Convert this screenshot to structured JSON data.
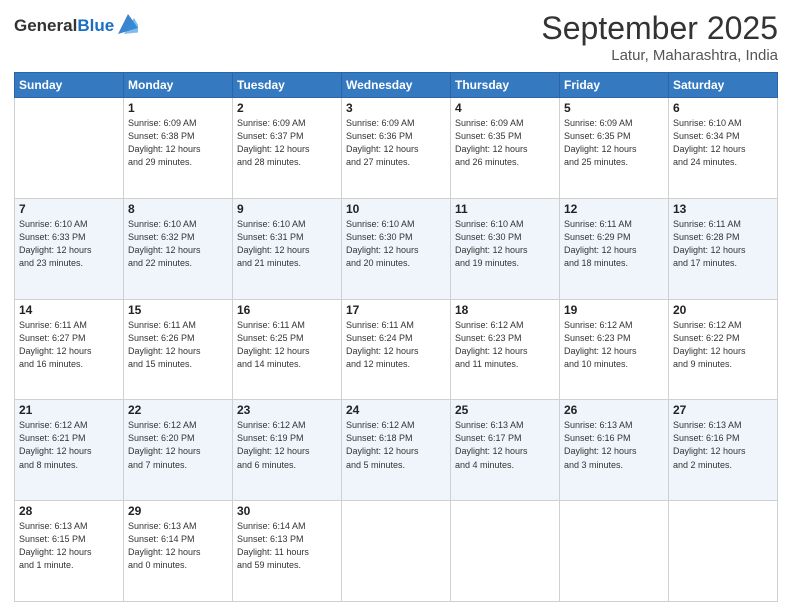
{
  "logo": {
    "general": "General",
    "blue": "Blue"
  },
  "header": {
    "month": "September 2025",
    "location": "Latur, Maharashtra, India"
  },
  "weekdays": [
    "Sunday",
    "Monday",
    "Tuesday",
    "Wednesday",
    "Thursday",
    "Friday",
    "Saturday"
  ],
  "weeks": [
    [
      {
        "day": "",
        "info": ""
      },
      {
        "day": "1",
        "info": "Sunrise: 6:09 AM\nSunset: 6:38 PM\nDaylight: 12 hours\nand 29 minutes."
      },
      {
        "day": "2",
        "info": "Sunrise: 6:09 AM\nSunset: 6:37 PM\nDaylight: 12 hours\nand 28 minutes."
      },
      {
        "day": "3",
        "info": "Sunrise: 6:09 AM\nSunset: 6:36 PM\nDaylight: 12 hours\nand 27 minutes."
      },
      {
        "day": "4",
        "info": "Sunrise: 6:09 AM\nSunset: 6:35 PM\nDaylight: 12 hours\nand 26 minutes."
      },
      {
        "day": "5",
        "info": "Sunrise: 6:09 AM\nSunset: 6:35 PM\nDaylight: 12 hours\nand 25 minutes."
      },
      {
        "day": "6",
        "info": "Sunrise: 6:10 AM\nSunset: 6:34 PM\nDaylight: 12 hours\nand 24 minutes."
      }
    ],
    [
      {
        "day": "7",
        "info": "Sunrise: 6:10 AM\nSunset: 6:33 PM\nDaylight: 12 hours\nand 23 minutes."
      },
      {
        "day": "8",
        "info": "Sunrise: 6:10 AM\nSunset: 6:32 PM\nDaylight: 12 hours\nand 22 minutes."
      },
      {
        "day": "9",
        "info": "Sunrise: 6:10 AM\nSunset: 6:31 PM\nDaylight: 12 hours\nand 21 minutes."
      },
      {
        "day": "10",
        "info": "Sunrise: 6:10 AM\nSunset: 6:30 PM\nDaylight: 12 hours\nand 20 minutes."
      },
      {
        "day": "11",
        "info": "Sunrise: 6:10 AM\nSunset: 6:30 PM\nDaylight: 12 hours\nand 19 minutes."
      },
      {
        "day": "12",
        "info": "Sunrise: 6:11 AM\nSunset: 6:29 PM\nDaylight: 12 hours\nand 18 minutes."
      },
      {
        "day": "13",
        "info": "Sunrise: 6:11 AM\nSunset: 6:28 PM\nDaylight: 12 hours\nand 17 minutes."
      }
    ],
    [
      {
        "day": "14",
        "info": "Sunrise: 6:11 AM\nSunset: 6:27 PM\nDaylight: 12 hours\nand 16 minutes."
      },
      {
        "day": "15",
        "info": "Sunrise: 6:11 AM\nSunset: 6:26 PM\nDaylight: 12 hours\nand 15 minutes."
      },
      {
        "day": "16",
        "info": "Sunrise: 6:11 AM\nSunset: 6:25 PM\nDaylight: 12 hours\nand 14 minutes."
      },
      {
        "day": "17",
        "info": "Sunrise: 6:11 AM\nSunset: 6:24 PM\nDaylight: 12 hours\nand 12 minutes."
      },
      {
        "day": "18",
        "info": "Sunrise: 6:12 AM\nSunset: 6:23 PM\nDaylight: 12 hours\nand 11 minutes."
      },
      {
        "day": "19",
        "info": "Sunrise: 6:12 AM\nSunset: 6:23 PM\nDaylight: 12 hours\nand 10 minutes."
      },
      {
        "day": "20",
        "info": "Sunrise: 6:12 AM\nSunset: 6:22 PM\nDaylight: 12 hours\nand 9 minutes."
      }
    ],
    [
      {
        "day": "21",
        "info": "Sunrise: 6:12 AM\nSunset: 6:21 PM\nDaylight: 12 hours\nand 8 minutes."
      },
      {
        "day": "22",
        "info": "Sunrise: 6:12 AM\nSunset: 6:20 PM\nDaylight: 12 hours\nand 7 minutes."
      },
      {
        "day": "23",
        "info": "Sunrise: 6:12 AM\nSunset: 6:19 PM\nDaylight: 12 hours\nand 6 minutes."
      },
      {
        "day": "24",
        "info": "Sunrise: 6:12 AM\nSunset: 6:18 PM\nDaylight: 12 hours\nand 5 minutes."
      },
      {
        "day": "25",
        "info": "Sunrise: 6:13 AM\nSunset: 6:17 PM\nDaylight: 12 hours\nand 4 minutes."
      },
      {
        "day": "26",
        "info": "Sunrise: 6:13 AM\nSunset: 6:16 PM\nDaylight: 12 hours\nand 3 minutes."
      },
      {
        "day": "27",
        "info": "Sunrise: 6:13 AM\nSunset: 6:16 PM\nDaylight: 12 hours\nand 2 minutes."
      }
    ],
    [
      {
        "day": "28",
        "info": "Sunrise: 6:13 AM\nSunset: 6:15 PM\nDaylight: 12 hours\nand 1 minute."
      },
      {
        "day": "29",
        "info": "Sunrise: 6:13 AM\nSunset: 6:14 PM\nDaylight: 12 hours\nand 0 minutes."
      },
      {
        "day": "30",
        "info": "Sunrise: 6:14 AM\nSunset: 6:13 PM\nDaylight: 11 hours\nand 59 minutes."
      },
      {
        "day": "",
        "info": ""
      },
      {
        "day": "",
        "info": ""
      },
      {
        "day": "",
        "info": ""
      },
      {
        "day": "",
        "info": ""
      }
    ]
  ]
}
